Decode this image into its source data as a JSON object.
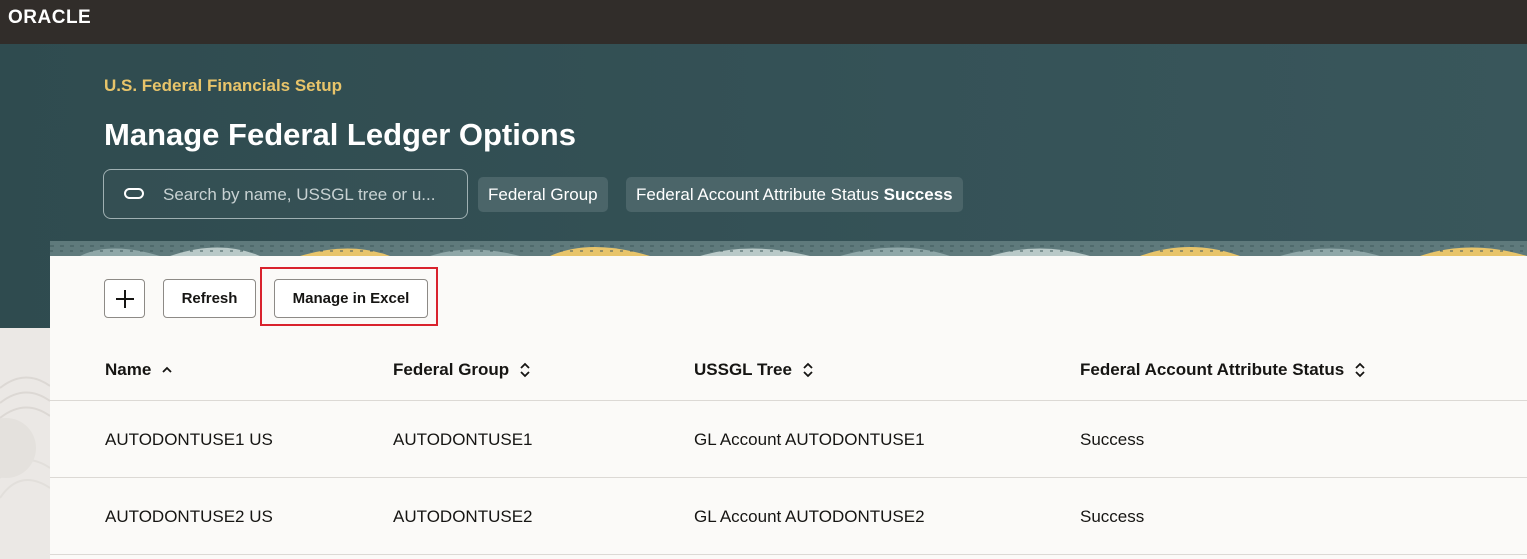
{
  "header": {
    "logo": "ORACLE"
  },
  "page": {
    "breadcrumb": "U.S. Federal Financials Setup",
    "title": "Manage Federal Ledger Options"
  },
  "search": {
    "placeholder": "Search by name, USSGL tree or u..."
  },
  "filters": [
    {
      "label": "Federal Group"
    },
    {
      "label": "Federal Account Attribute Status",
      "value": "Success"
    }
  ],
  "toolbar": {
    "add_icon": "plus-icon",
    "refresh_label": "Refresh",
    "excel_label": "Manage in Excel"
  },
  "table": {
    "columns": [
      {
        "label": "Name",
        "sort_icon": "sort-ascending-icon"
      },
      {
        "label": "Federal Group",
        "sort_icon": "sort-both-icon"
      },
      {
        "label": "USSGL Tree",
        "sort_icon": "sort-both-icon"
      },
      {
        "label": "Federal Account Attribute Status",
        "sort_icon": "sort-both-icon"
      }
    ],
    "rows": [
      [
        "AUTODONTUSE1 US",
        "AUTODONTUSE1",
        "GL Account AUTODONTUSE1",
        "Success"
      ],
      [
        "AUTODONTUSE2 US",
        "AUTODONTUSE2",
        "GL Account AUTODONTUSE2",
        "Success"
      ]
    ]
  },
  "colors": {
    "topbar": "#312d2a",
    "hero": "#355257",
    "breadcrumb": "#e8c46a",
    "highlight": "#d9222d"
  }
}
